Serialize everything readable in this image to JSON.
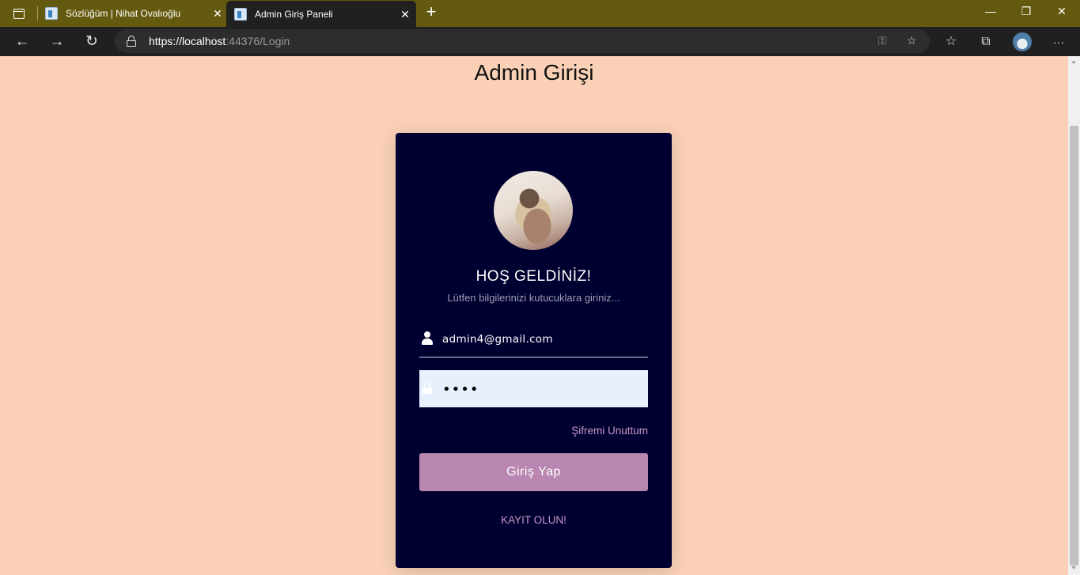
{
  "browser": {
    "tabs": [
      {
        "title": "Sözlüğüm | Nihat Ovalıoğlu",
        "active": false
      },
      {
        "title": "Admin Giriş Paneli",
        "active": true
      }
    ],
    "address": {
      "host": "https://localhost",
      "rest": ":44376/Login"
    },
    "colors": {
      "tabbar": "#645a0f",
      "toolbar": "#202020"
    }
  },
  "page": {
    "title": "Admin Girişi",
    "background": "#fad1b6"
  },
  "login_card": {
    "background": "#000030",
    "welcome": "HOŞ GELDİNİZ!",
    "subtitle": "Lütfen bilgilerinizi kutucuklara giriniz...",
    "email_value": "admin4@gmail.com",
    "password_value": "••••",
    "forgot_link": "Şifremi Unuttum",
    "login_button": "Giriş Yap",
    "register_link": "KAYIT OLUN!",
    "accent_color": "#b886b0"
  }
}
